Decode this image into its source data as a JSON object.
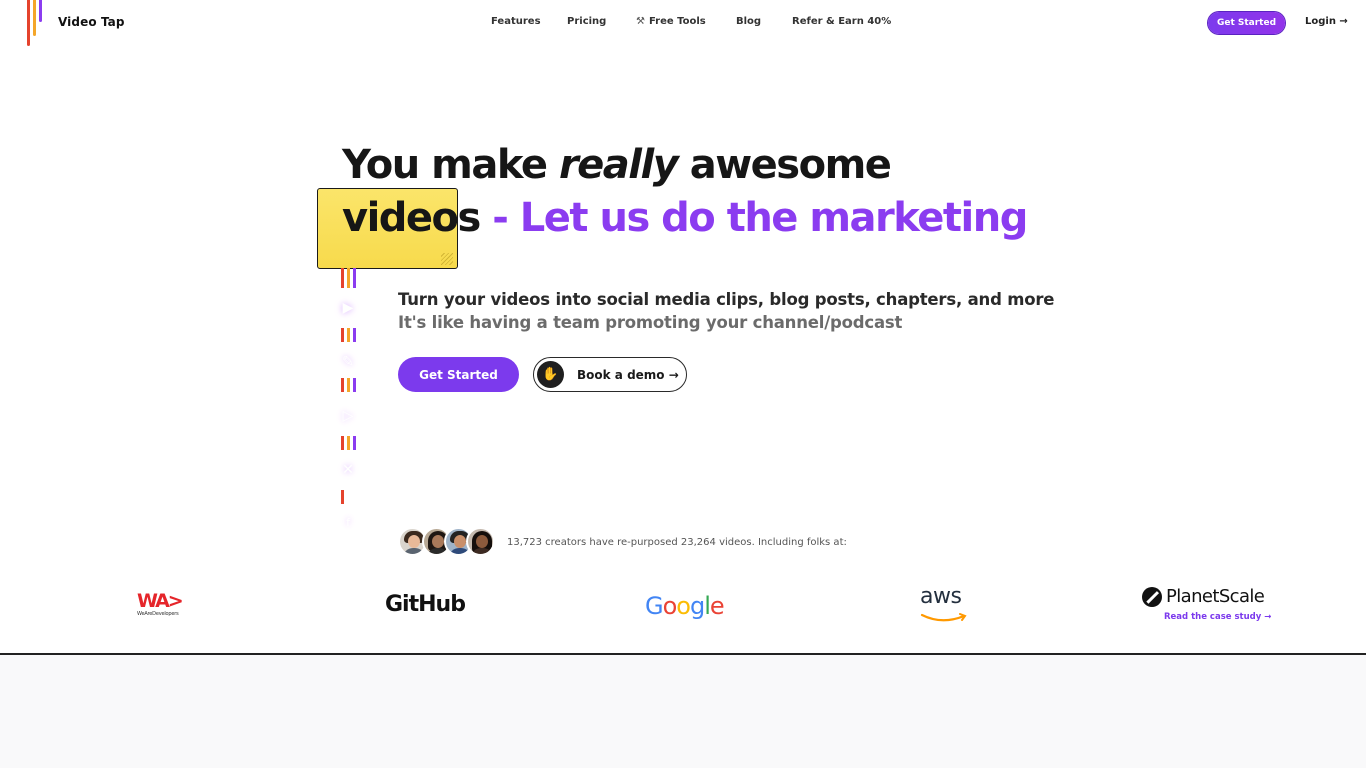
{
  "header": {
    "brand": "Video Tap",
    "nav": [
      {
        "label": "Features"
      },
      {
        "label": "Pricing"
      },
      {
        "label": "Free Tools",
        "icon": "tools-icon"
      },
      {
        "label": "Blog"
      },
      {
        "label": "Refer & Earn 40%"
      }
    ],
    "cta_label": "Get Started",
    "login_label": "Login →"
  },
  "hero": {
    "line1_a": "You make ",
    "line1_em": "really",
    "line1_b": " awesome",
    "line2_a": "videos",
    "line2_b": " - Let us do the marketing",
    "subtitle": "Turn your videos into social media clips, blog posts, chapters, and more",
    "subtitle2": "It's like having a team promoting your channel/podcast",
    "primary_button": "Get Started",
    "demo_button": "Book a demo →",
    "demo_icon": "waving-hand-icon"
  },
  "timeline_icons": [
    "clip-icon",
    "pen-icon",
    "play-icon",
    "x-icon",
    "facebook-icon"
  ],
  "social_proof": {
    "text": "13,723 creators have re-purposed 23,264 videos. Including folks at:"
  },
  "logos": {
    "wad_mark": "WA>",
    "wad_small": "WeAreDevelopers",
    "github": "GitHub",
    "google": "Google",
    "aws": "aws",
    "planetscale": "PlanetScale",
    "case_study": "Read the case study →"
  },
  "colors": {
    "accent": "#7c3aed",
    "highlight": "#8b3cf0",
    "sticky": "#f7da4c",
    "red": "#e5432d",
    "orange": "#f4a62a"
  }
}
